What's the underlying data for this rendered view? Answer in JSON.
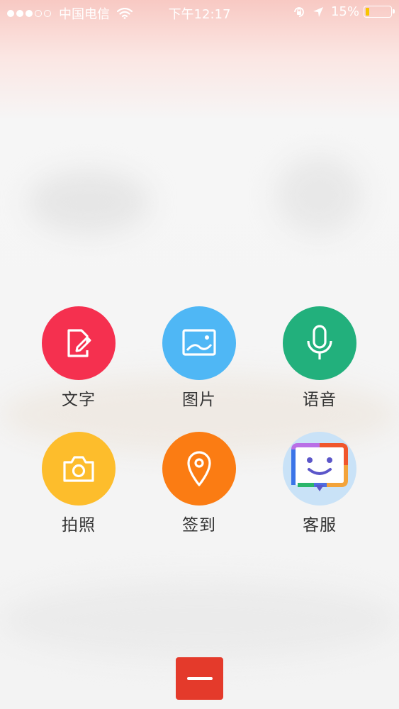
{
  "status_bar": {
    "signal_dots": [
      true,
      true,
      true,
      false,
      false
    ],
    "carrier": "中国电信",
    "time": "下午12:17",
    "battery_percent": "15%",
    "battery_level": 0.15,
    "icons": [
      "wifi-icon",
      "orientation-lock-icon",
      "location-arrow-icon",
      "battery-icon"
    ]
  },
  "menu": {
    "items": [
      {
        "label": "文字",
        "color": "#f5304f",
        "icon": "edit-document-icon"
      },
      {
        "label": "图片",
        "color": "#4fb7f5",
        "icon": "picture-icon"
      },
      {
        "label": "语音",
        "color": "#22b07c",
        "icon": "microphone-icon"
      },
      {
        "label": "拍照",
        "color": "#fdbd2c",
        "icon": "camera-icon"
      },
      {
        "label": "签到",
        "color": "#fb7c13",
        "icon": "location-pin-icon"
      },
      {
        "label": "客服",
        "color": "#c9e2f7",
        "icon": "customer-service-face-icon"
      }
    ]
  },
  "close_button": {
    "color": "#e43a2b",
    "icon": "minus-icon"
  }
}
